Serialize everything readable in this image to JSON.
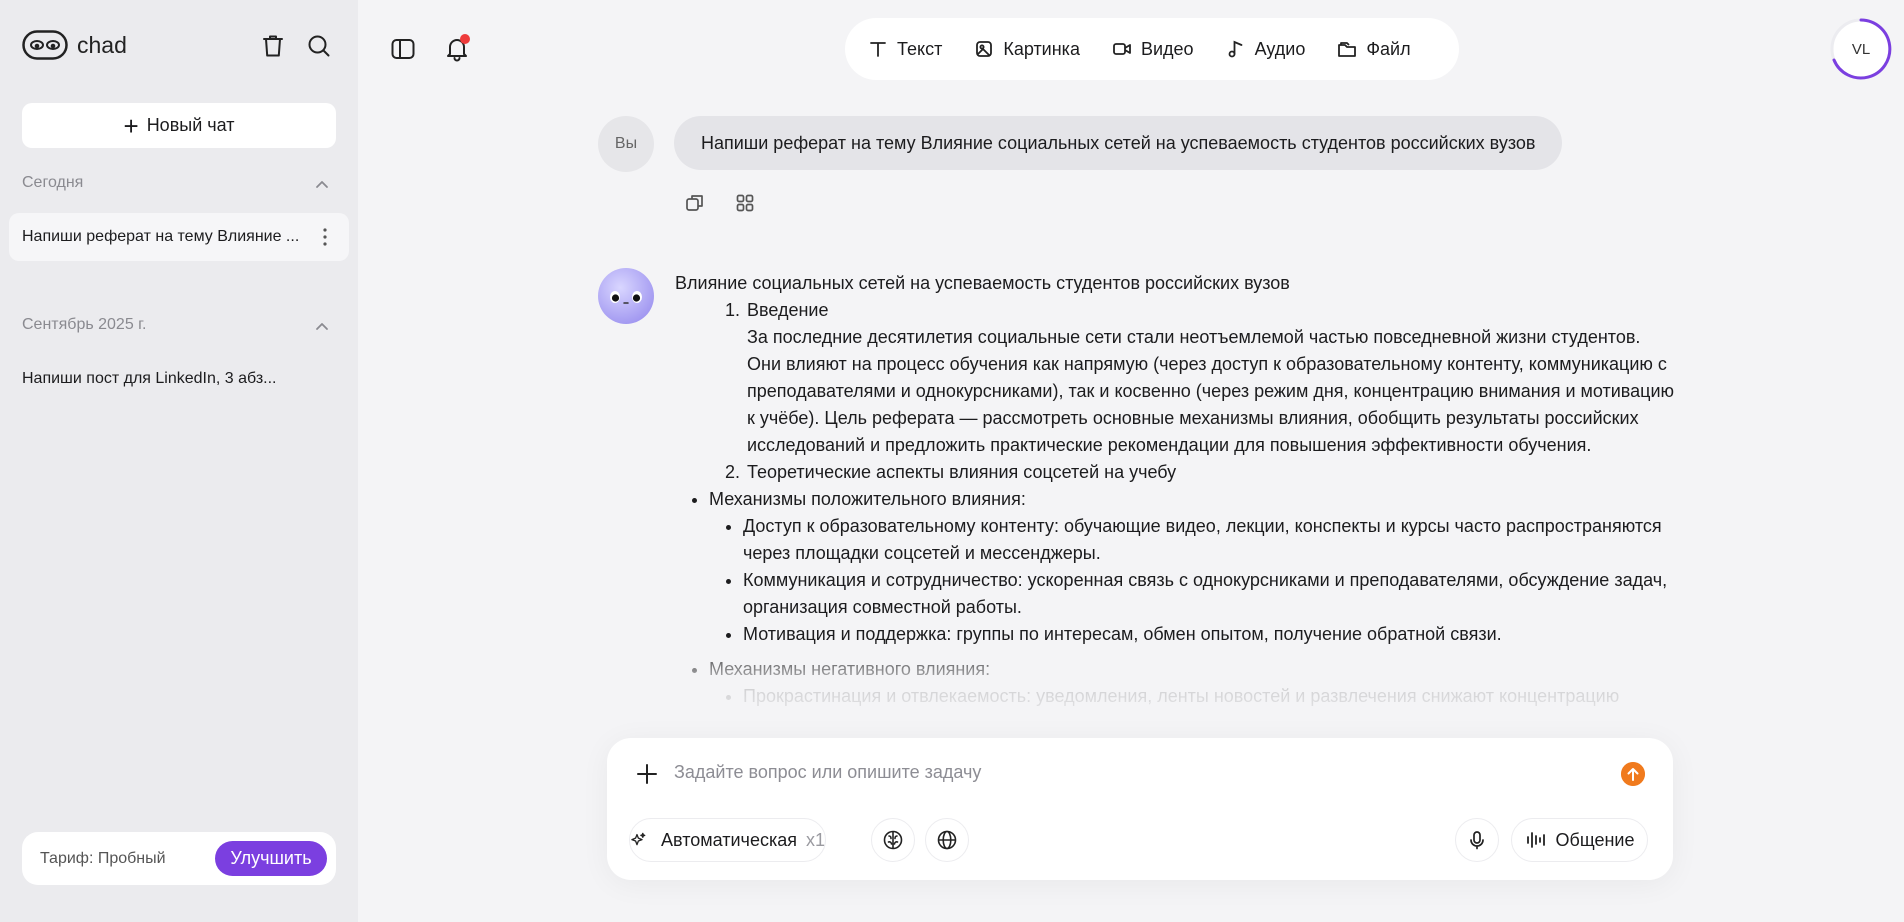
{
  "sidebar": {
    "brand": "chad",
    "new_chat": "Новый чат",
    "sections": [
      {
        "label": "Сегодня",
        "items": [
          "Напиши реферат на тему Влияние ..."
        ]
      },
      {
        "label": "Сентябрь 2025 г.",
        "items": [
          "Напиши пост для LinkedIn, 3 абз..."
        ]
      }
    ],
    "tariff_label": "Тариф: Пробный",
    "upgrade_label": "Улучшить"
  },
  "modes": [
    "Текст",
    "Картинка",
    "Видео",
    "Аудио",
    "Файл"
  ],
  "user_avatar": "VL",
  "chat": {
    "you_label": "Вы",
    "user_message": "Напиши реферат на тему Влияние социальных сетей на успеваемость студентов российских вузов",
    "answer": {
      "title": "Влияние социальных сетей на успеваемость студентов российских вузов",
      "ol1_title": "Введение",
      "ol1_text": "За последние десятилетия социальные сети стали неотъемлемой частью повседневной жизни студентов. Они влияют на процесс обучения как напрямую (через доступ к образовательному контенту, коммуникацию с преподавателями и однокурсниками), так и косвенно (через режим дня, концентрацию внимания и мотивацию к учёбе). Цель реферата — рассмотреть основные механизмы влияния, обобщить результаты российских исследований и предложить практические рекомендации для повышения эффективности обучения.",
      "ol2_title": "Теоретические аспекты влияния соцсетей на учебу",
      "pos_title": "Механизмы положительного влияния:",
      "pos_items": [
        "Доступ к образовательному контенту: обучающие видео, лекции, конспекты и курсы часто распространяются через площадки соцсетей и мессенджеры.",
        "Коммуникация и сотрудничество: ускоренная связь с однокурсниками и преподавателями, обсуждение задач, организация совместной работы.",
        "Мотивация и поддержка: группы по интересам, обмен опытом, получение обратной связи."
      ],
      "neg_title": "Механизмы негативного влияния:",
      "neg_items": [
        "Прокрастинация и отвлекаемость: уведомления, ленты новостей и развлечения снижают концентрацию"
      ]
    }
  },
  "composer": {
    "placeholder": "Задайте вопрос или опишите задачу",
    "model_label": "Автоматическая",
    "model_multiplier": "x1",
    "voice_label": "Общение"
  },
  "colors": {
    "accent": "#7b3fe0",
    "send": "#f07a1d",
    "notification": "#ee3b3b"
  }
}
